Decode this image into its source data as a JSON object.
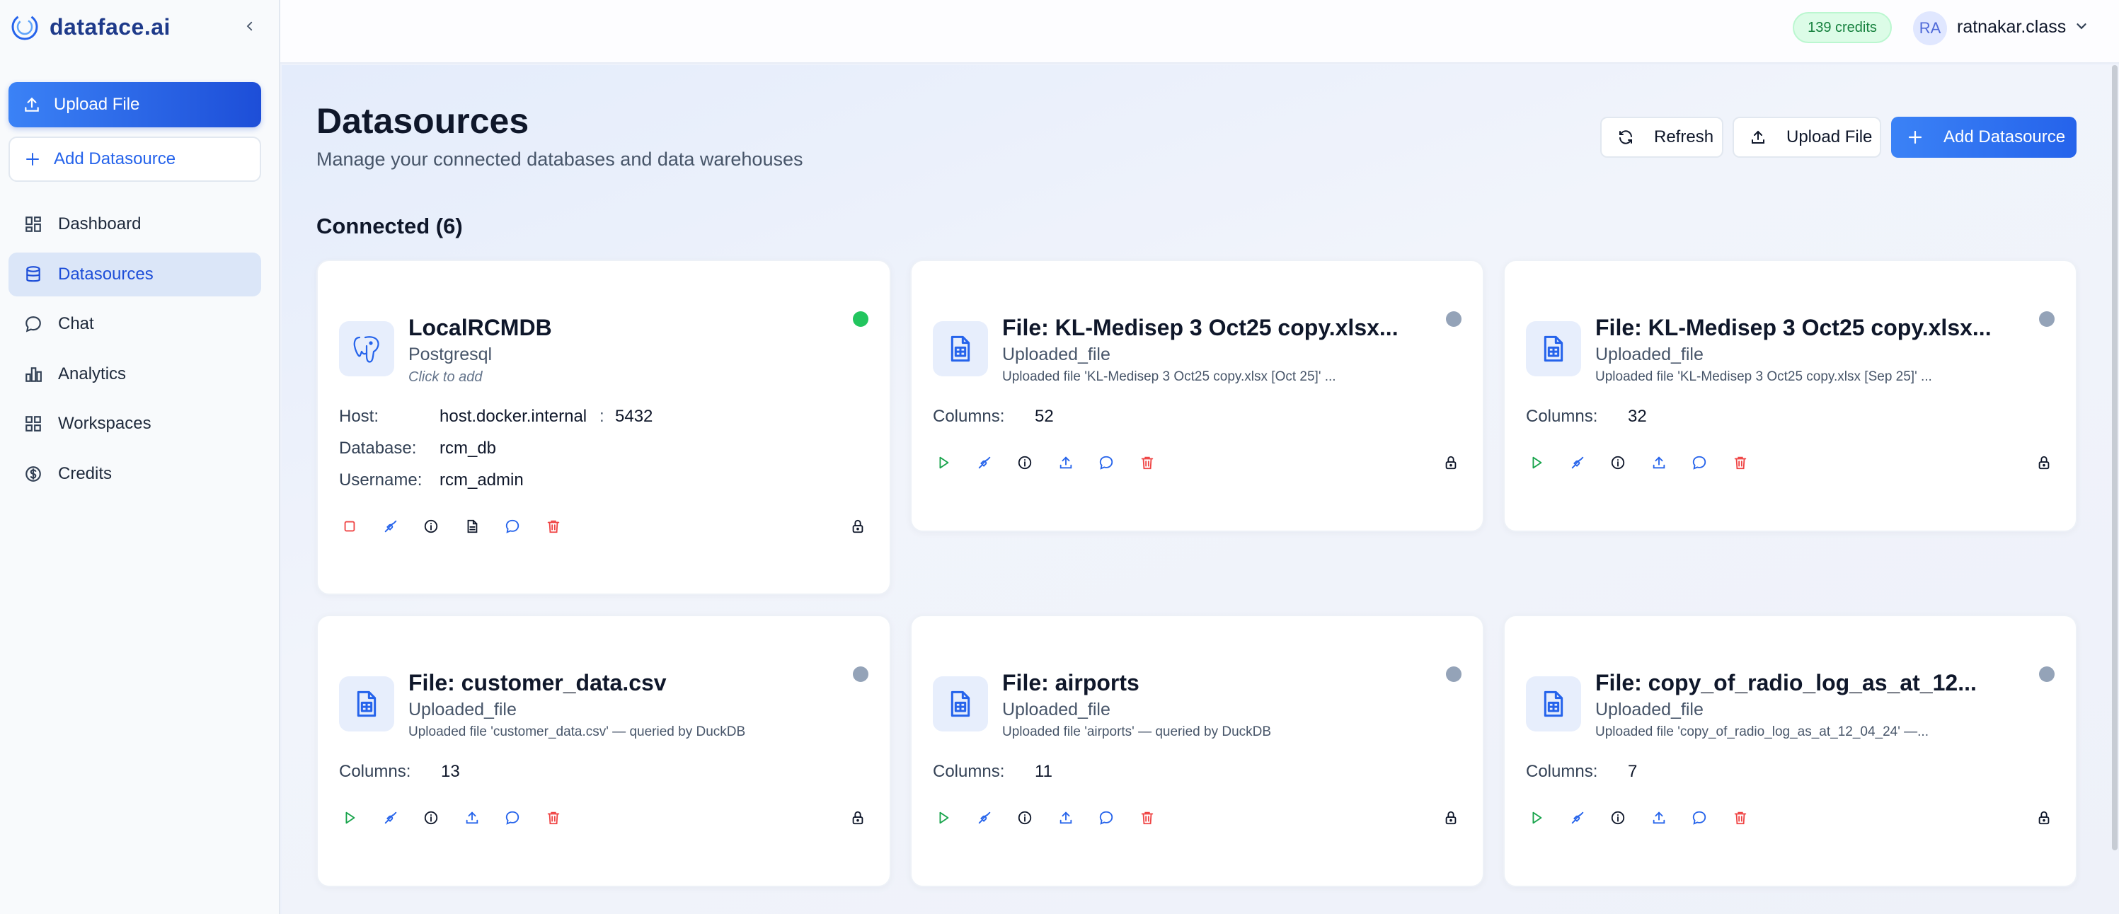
{
  "brand": {
    "name": "dataface.ai"
  },
  "sidebar": {
    "upload_label": "Upload File",
    "add_label": "Add Datasource",
    "items": [
      {
        "label": "Dashboard",
        "icon": "dashboard-icon"
      },
      {
        "label": "Datasources",
        "icon": "database-icon",
        "active": true
      },
      {
        "label": "Chat",
        "icon": "chat-icon"
      },
      {
        "label": "Analytics",
        "icon": "analytics-icon"
      },
      {
        "label": "Workspaces",
        "icon": "workspaces-icon"
      },
      {
        "label": "Credits",
        "icon": "dollar-icon"
      }
    ]
  },
  "topbar": {
    "credits": "139 credits",
    "avatar_initials": "RA",
    "username": "ratnakar.class"
  },
  "page": {
    "title": "Datasources",
    "subtitle": "Manage your connected databases and data warehouses",
    "refresh_label": "Refresh",
    "upload_label": "Upload File",
    "add_label": "Add Datasource",
    "section_title": "Connected (6)"
  },
  "colors": {
    "accent": "#2563eb",
    "connected": "#22c55e",
    "disconnected": "#94a3b8",
    "danger": "#ef4444",
    "play": "#16a34a"
  },
  "cards": [
    {
      "title": "LocalRCMDB",
      "type": "Postgresql",
      "hint": "Click to add",
      "status": "connected",
      "host_label": "Host:",
      "host": "host.docker.internal",
      "port_sep": ":",
      "port": "5432",
      "database_label": "Database:",
      "database": "rcm_db",
      "username_label": "Username:",
      "username": "rcm_admin"
    },
    {
      "title": "File: KL-Medisep 3 Oct25 copy.xlsx...",
      "type": "Uploaded_file",
      "desc": "Uploaded file 'KL-Medisep 3 Oct25 copy.xlsx [Oct 25]' ...",
      "status": "idle",
      "columns_label": "Columns:",
      "columns": "52"
    },
    {
      "title": "File: KL-Medisep 3 Oct25 copy.xlsx...",
      "type": "Uploaded_file",
      "desc": "Uploaded file 'KL-Medisep 3 Oct25 copy.xlsx [Sep 25]' ...",
      "status": "idle",
      "columns_label": "Columns:",
      "columns": "32"
    },
    {
      "title": "File: customer_data.csv",
      "type": "Uploaded_file",
      "desc": "Uploaded file 'customer_data.csv' — queried by DuckDB",
      "status": "idle",
      "columns_label": "Columns:",
      "columns": "13"
    },
    {
      "title": "File: airports",
      "type": "Uploaded_file",
      "desc": "Uploaded file 'airports' — queried by DuckDB",
      "status": "idle",
      "columns_label": "Columns:",
      "columns": "11"
    },
    {
      "title": "File: copy_of_radio_log_as_at_12...",
      "type": "Uploaded_file",
      "desc": "Uploaded file 'copy_of_radio_log_as_at_12_04_24' —...",
      "status": "idle",
      "columns_label": "Columns:",
      "columns": "7"
    }
  ]
}
